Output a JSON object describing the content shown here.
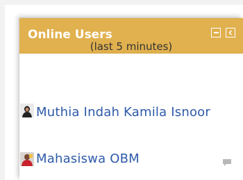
{
  "block": {
    "title": "Online Users",
    "subtitle": "(last 5 minutes)",
    "users": [
      {
        "name": "Muthia Indah Kamila Isnoor"
      },
      {
        "name": "Mahasiswa OBM"
      }
    ]
  },
  "colors": {
    "header": "#e1b14f",
    "link": "#2e5aa8"
  },
  "icons": {
    "hide": "minus-box-icon",
    "dock": "chevron-left-box-icon",
    "message": "speech-bubble-icon"
  }
}
